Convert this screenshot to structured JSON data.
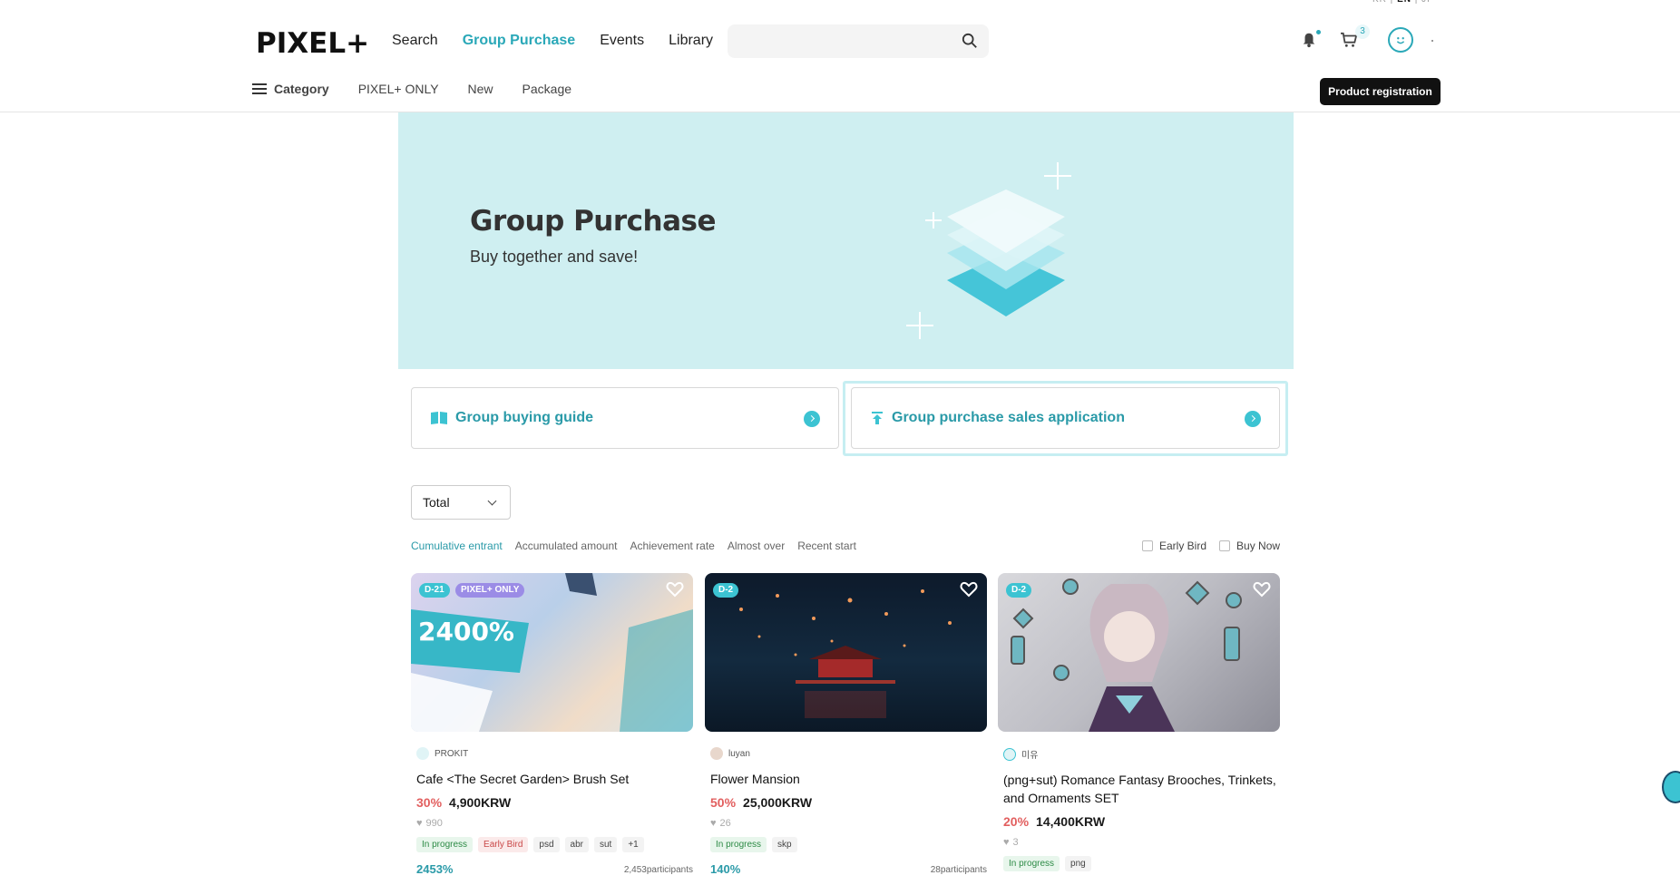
{
  "lang": {
    "kr": "KR",
    "en": "EN",
    "jp": "JP"
  },
  "header": {
    "logo": "PIXEL+",
    "nav": [
      "Search",
      "Group Purchase",
      "Events",
      "Library"
    ],
    "search_placeholder": "",
    "cart_count": "3"
  },
  "subnav": {
    "category": "Category",
    "items": [
      "PIXEL+ ONLY",
      "New",
      "Package"
    ],
    "product_registration": "Product registration"
  },
  "banner": {
    "title": "Group Purchase",
    "subtitle": "Buy together and save!"
  },
  "actions": {
    "guide": "Group buying guide",
    "application": "Group purchase sales application"
  },
  "filter": {
    "select": "Total",
    "sorts": [
      "Cumulative entrant",
      "Accumulated amount",
      "Achievement rate",
      "Almost over",
      "Recent start"
    ],
    "early_bird": "Early Bird",
    "buy_now": "Buy Now"
  },
  "products": [
    {
      "dday": "D-21",
      "only": "PIXEL+ ONLY",
      "seller": "PROKIT",
      "title": "Cafe <The Secret Garden> Brush Set",
      "discount": "30%",
      "price": "4,900KRW",
      "likes": "990",
      "tags": [
        "In progress",
        "Early Bird",
        "psd",
        "abr",
        "sut",
        "+1"
      ],
      "progress": "2453%",
      "participants": "2,453participants",
      "thumb_text": "2400%"
    },
    {
      "dday": "D-2",
      "seller": "luyan",
      "title": "Flower Mansion",
      "discount": "50%",
      "price": "25,000KRW",
      "likes": "26",
      "tags": [
        "In progress",
        "skp"
      ],
      "progress": "140%",
      "participants": "28participants"
    },
    {
      "dday": "D-2",
      "seller": "미유",
      "title": "(png+sut) Romance Fantasy Brooches, Trinkets, and Ornaments SET",
      "discount": "20%",
      "price": "14,400KRW",
      "likes": "3",
      "tags": [
        "In progress",
        "png"
      ]
    }
  ],
  "colors": {
    "accent": "#2aa8b8",
    "banner_bg": "#cfeff1",
    "discount": "#e25f5f"
  }
}
